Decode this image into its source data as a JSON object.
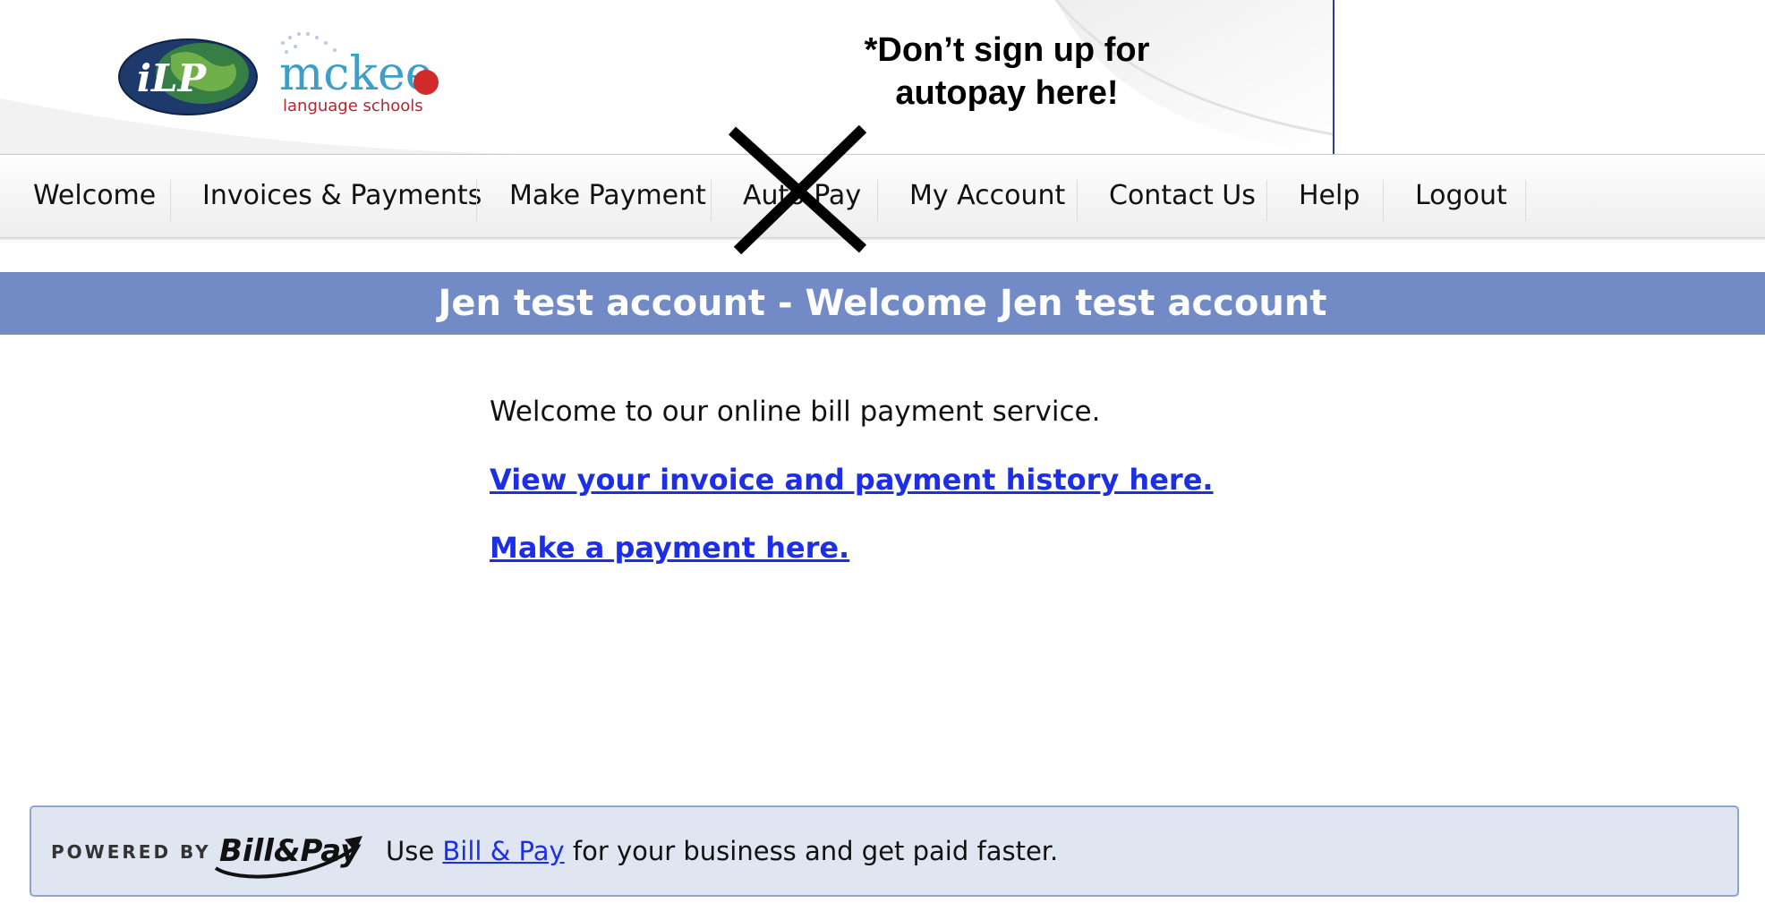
{
  "header": {
    "note_line1": "*Don’t sign up for",
    "note_line2": "autopay here!",
    "logo_ilp_text": "iLP",
    "logo_mckee_text": "mckee",
    "logo_mckee_sub": "language schools"
  },
  "nav": {
    "items": [
      {
        "label": "Welcome"
      },
      {
        "label": "Invoices & Payments"
      },
      {
        "label": "Make Payment"
      },
      {
        "label": "Auto Pay"
      },
      {
        "label": "My Account"
      },
      {
        "label": "Contact Us"
      },
      {
        "label": "Help"
      },
      {
        "label": "Logout"
      }
    ]
  },
  "title_bar": {
    "text": "Jen test account - Welcome Jen test account"
  },
  "content": {
    "intro": "Welcome to our online bill payment service.",
    "link_history": "View your invoice and payment history here.",
    "link_payment": "Make a payment here."
  },
  "footer": {
    "powered_by": "POWERED BY",
    "logo_text": "Bill&Pay",
    "text_before": "Use ",
    "link_text": "Bill & Pay",
    "text_after": " for your business and get paid faster."
  },
  "colors": {
    "title_bar_bg": "#728bc7",
    "link": "#1d2fe6",
    "footer_bg": "#dfe5f1"
  }
}
